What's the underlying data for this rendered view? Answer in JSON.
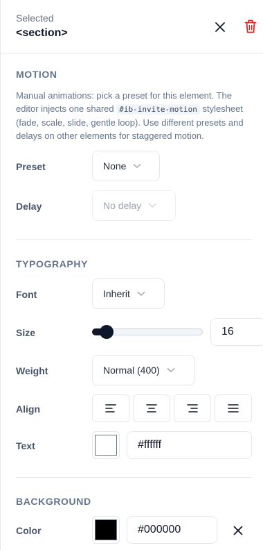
{
  "header": {
    "selected_label": "Selected",
    "selected_tag": "<section>",
    "close_icon": "close-icon",
    "delete_icon": "trash-icon",
    "delete_color": "#dc2626"
  },
  "motion": {
    "title": "MOTION",
    "desc_before": "Manual animations: pick a preset for this element. The editor injects one shared ",
    "desc_code": "#ib-invite-motion",
    "desc_after": " stylesheet (fade, scale, slide, gentle loop). Use different presets and delays on other elements for staggered motion.",
    "preset_label": "Preset",
    "preset_value": "None",
    "delay_label": "Delay",
    "delay_value": "No delay"
  },
  "typography": {
    "title": "TYPOGRAPHY",
    "font_label": "Font",
    "font_value": "Inherit",
    "size_label": "Size",
    "size_value": "16",
    "size_slider_fraction": 0.13,
    "weight_label": "Weight",
    "weight_value": "Normal (400)",
    "align_label": "Align",
    "align_options": [
      "align-left-icon",
      "align-center-icon",
      "align-right-icon",
      "align-justify-icon"
    ],
    "text_label": "Text",
    "text_color": "#ffffff",
    "text_hex": "#ffffff"
  },
  "background": {
    "title": "BACKGROUND",
    "color_label": "Color",
    "color": "#000000",
    "color_hex": "#000000",
    "clear_icon": "close-icon"
  }
}
